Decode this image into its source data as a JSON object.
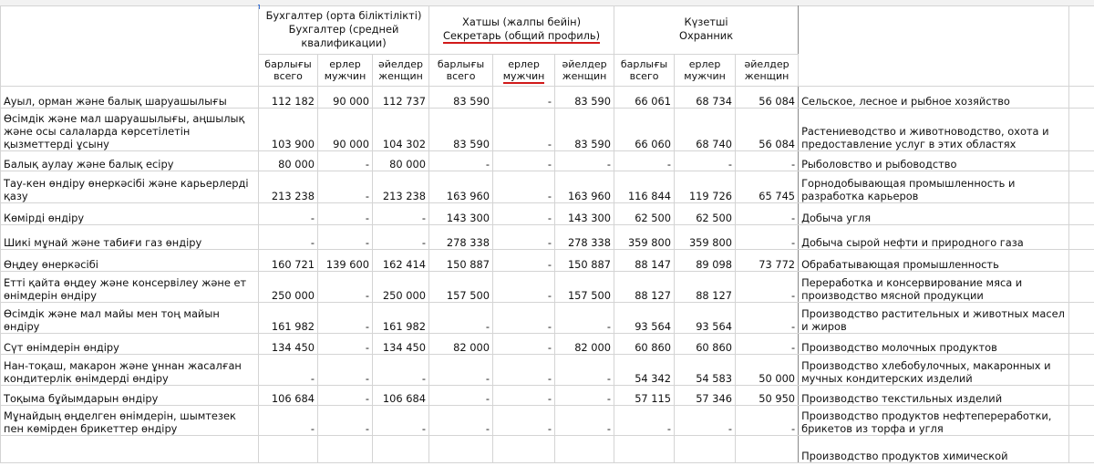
{
  "header": {
    "col_groups": [
      {
        "kz": "Бухгалтер (орта біліктілікті)",
        "ru": "Бухгалтер  (средней квалификации)"
      },
      {
        "kz": "Хатшы (жалпы бейін)",
        "ru": "Секретарь (общий профиль)"
      },
      {
        "kz": "Күзетші",
        "ru": "Охранник"
      }
    ],
    "subheaders": [
      {
        "kz": "барлығы",
        "ru": "всего"
      },
      {
        "kz": "ерлер",
        "ru": "мужчин"
      },
      {
        "kz": "әйелдер",
        "ru": "женщин"
      }
    ]
  },
  "rows": [
    {
      "kz": "Ауыл, орман және балық шаруашылығы",
      "v": [
        "112 182",
        "90 000",
        "112 737",
        "83 590",
        "-",
        "83 590",
        "66 061",
        "68 734",
        "56 084"
      ],
      "ru": "Сельское, лесное и рыбное хозяйство"
    },
    {
      "kz": "Өсімдік және мал шаруашылығы, аңшылық және осы салаларда көрсетілетін қызметтерді ұсыну",
      "v": [
        "103 900",
        "90 000",
        "104 302",
        "83 590",
        "-",
        "83 590",
        "66 060",
        "68 740",
        "56 084"
      ],
      "ru": "Растениеводство и животноводство, охота и предоставление услуг в этих областях"
    },
    {
      "kz": "Балық аулау және балық есіру",
      "v": [
        "80 000",
        "-",
        "80 000",
        "-",
        "-",
        "-",
        "-",
        "-",
        "-"
      ],
      "ru": "Рыболовство и рыбоводство"
    },
    {
      "kz": "Тау-кен өндіру өнеркәсібі және карьерлерді қазу",
      "v": [
        "213 238",
        "-",
        "213 238",
        "163 960",
        "-",
        "163 960",
        "116 844",
        "119 726",
        "65 745"
      ],
      "ru": "Горнодобывающая промышленность и разработка карьеров"
    },
    {
      "kz": "Көмірді өндіру",
      "v": [
        "-",
        "-",
        "-",
        "143 300",
        "-",
        "143 300",
        "62 500",
        "62 500",
        "-"
      ],
      "ru": "Добыча угля"
    },
    {
      "kz": "Шикі мұнай және табиғи газ өндіру",
      "v": [
        "-",
        "-",
        "-",
        "278 338",
        "-",
        "278 338",
        "359 800",
        "359 800",
        "-"
      ],
      "ru": "Добыча сырой нефти и природного газа"
    },
    {
      "kz": "Өңдеу өнеркәсібі",
      "v": [
        "160 721",
        "139 600",
        "162 414",
        "150 887",
        "-",
        "150 887",
        "88 147",
        "89 098",
        "73 772"
      ],
      "ru": "Обрабатывающая промышленность"
    },
    {
      "kz": "Етті қайта өңдеу және консервілеу және ет өнімдерін өндіру",
      "v": [
        "250 000",
        "-",
        "250 000",
        "157 500",
        "-",
        "157 500",
        "88 127",
        "88 127",
        "-"
      ],
      "ru": "Переработка и консервирование мяса и производство мясной продукции"
    },
    {
      "kz": "Өсімдік және мал майы мен тоң майын өндіру",
      "v": [
        "161 982",
        "-",
        "161 982",
        "-",
        "-",
        "-",
        "93 564",
        "93 564",
        "-"
      ],
      "ru": "Производство растительных и животных масел и жиров"
    },
    {
      "kz": "Сүт өнімдерін өндіру",
      "v": [
        "134 450",
        "-",
        "134 450",
        "82 000",
        "-",
        "82 000",
        "60 860",
        "60 860",
        "-"
      ],
      "ru": "Производство молочных продуктов"
    },
    {
      "kz": "Нан-тоқаш, макарон және ұннан жасалған кондитерлік өнімдерді өндіру",
      "v": [
        "-",
        "-",
        "-",
        "-",
        "-",
        "-",
        "54 342",
        "54 583",
        "50 000"
      ],
      "ru": "Производство  хлебобулочных, макаронных и мучных кондитерских изделий"
    },
    {
      "kz": "Тоқыма бұйымдарын өндіру",
      "v": [
        "106 684",
        "-",
        "106 684",
        "-",
        "-",
        "-",
        "57 115",
        "57 346",
        "50 950"
      ],
      "ru": "Производство текстильных изделий"
    },
    {
      "kz": "Мұнайдың өңделген өнімдерін, шымтезек пен көмірден брикеттер өндіру",
      "v": [
        "-",
        "-",
        "-",
        "-",
        "-",
        "-",
        "-",
        "-",
        "-"
      ],
      "ru": "Производство продуктов нефтепереработки, брикетов из торфа и угля"
    },
    {
      "kz": "",
      "v": [
        "",
        "",
        "",
        "",
        "",
        "",
        "",
        "",
        ""
      ],
      "ru": "Производство продуктов химической"
    }
  ]
}
